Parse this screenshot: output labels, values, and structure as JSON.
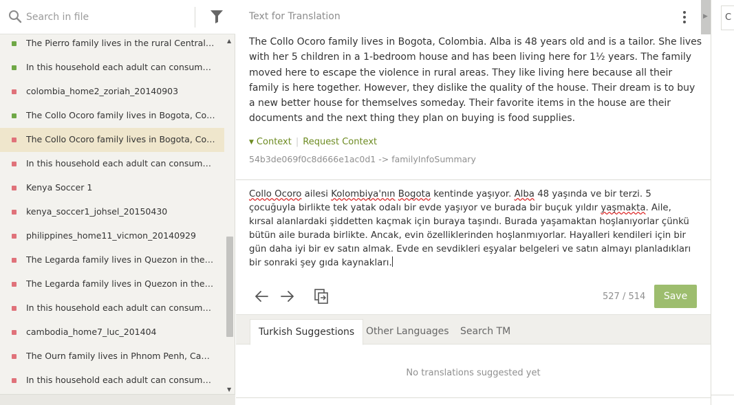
{
  "search": {
    "placeholder": "Search in file"
  },
  "segments": [
    {
      "text": "The Pierro family lives in the rural Central Province of Zambia",
      "status": "green",
      "active": false
    },
    {
      "text": "In this household each adult can consume up to",
      "status": "green",
      "active": false
    },
    {
      "text": "colombia_home2_zoriah_20140903",
      "status": "red",
      "active": false
    },
    {
      "text": "The Collo Ocoro family lives in Bogota, Colombia",
      "status": "green",
      "active": false
    },
    {
      "text": "The Collo Ocoro family lives in Bogota, Colombia",
      "status": "red",
      "active": true
    },
    {
      "text": "In this household each adult can consume up to",
      "status": "red",
      "active": false
    },
    {
      "text": "Kenya Soccer 1",
      "status": "red",
      "active": false
    },
    {
      "text": "kenya_soccer1_johsel_20150430",
      "status": "red",
      "active": false
    },
    {
      "text": "philippines_home11_vicmon_20140929",
      "status": "red",
      "active": false
    },
    {
      "text": "The Legarda family lives in Quezon in the Philippines",
      "status": "red",
      "active": false
    },
    {
      "text": "The Legarda family lives in Quezon in the Philippines",
      "status": "red",
      "active": false
    },
    {
      "text": "In this household each adult can consume up to",
      "status": "red",
      "active": false
    },
    {
      "text": "cambodia_home7_luc_201404",
      "status": "red",
      "active": false
    },
    {
      "text": "The Ourn family lives in Phnom Penh, Cambodia",
      "status": "red",
      "active": false
    },
    {
      "text": "In this household each adult can consume up to",
      "status": "red",
      "active": false
    }
  ],
  "editor": {
    "source_title": "Text for Translation",
    "source_text": "The Collo Ocoro family lives in Bogota, Colombia. Alba is 48 years old and is a tailor. She lives with her 5 children in a 1-bedroom house and has been living here for 1½ years. The family moved here to escape the violence in rural areas. They like living here because all their family is here together. However, they dislike the quality of the house. Their dream is to buy a new better house for themselves someday. Their favorite items in the house are their documents and the next thing they plan on buying is food supplies.",
    "context_label": "Context",
    "request_context_label": "Request Context",
    "context_key": "54b3de069f0c8d666e1ac0d1 -> familyInfoSummary",
    "target_parts": [
      {
        "t": "Collo Ocoro",
        "spell": true
      },
      {
        "t": " ailesi ",
        "spell": false
      },
      {
        "t": "Kolombiya'nın",
        "spell": true
      },
      {
        "t": " ",
        "spell": false
      },
      {
        "t": "Bogota",
        "spell": true
      },
      {
        "t": " kentinde yaşıyor. ",
        "spell": false
      },
      {
        "t": "Alba",
        "spell": true
      },
      {
        "t": " 48 yaşında ve bir terzi. 5 çocuğuyla birlikte tek yatak odalı bir evde yaşıyor ve burada bir buçuk yıldır ",
        "spell": false
      },
      {
        "t": "yaşmakta",
        "spell": true
      },
      {
        "t": ". Aile, kırsal alanlardaki şiddetten kaçmak için buraya taşındı. Burada yaşamaktan hoşlanıyorlar çünkü bütün aile burada birlikte. Ancak, evin özelliklerinden hoşlanmıyorlar. Hayalleri kendileri için bir gün  daha iyi bir ev satın almak. Evde en sevdikleri eşyalar belgeleri ve satın almayı planladıkları bir sonraki şey gıda kaynakları.",
        "spell": false
      }
    ],
    "char_count": "527 / 514",
    "save_label": "Save"
  },
  "suggestions": {
    "tabs": [
      "Turkish Suggestions",
      "Other Languages",
      "Search TM"
    ],
    "active_tab": 0,
    "empty_message": "No translations suggested yet"
  },
  "right_panel": {
    "tab_label": "C"
  },
  "colors": {
    "accent_green": "#6fa846",
    "status_red": "#e0727a",
    "save_button": "#9dbd6e",
    "context_link": "#6d8b22",
    "active_row": "#efe6cc"
  },
  "icons": [
    "search-icon",
    "filter-icon",
    "kebab-menu-icon",
    "arrow-left-icon",
    "arrow-right-icon",
    "copy-source-icon"
  ]
}
